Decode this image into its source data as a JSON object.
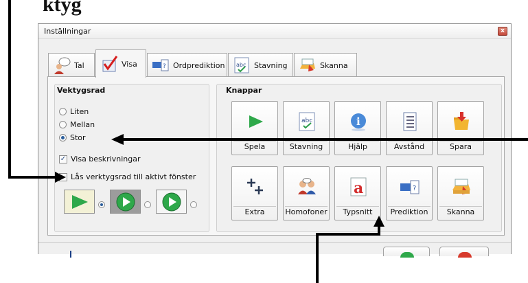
{
  "heading": "ktyg",
  "window": {
    "title": "Inställningar",
    "close_glyph": "x"
  },
  "tabs": [
    {
      "label": "Tal",
      "icon": "speaking-person-icon"
    },
    {
      "label": "Visa",
      "icon": "checkmark-icon",
      "selected": true
    },
    {
      "label": "Ordprediktion",
      "icon": "prediction-icon"
    },
    {
      "label": "Stavning",
      "icon": "spelling-icon"
    },
    {
      "label": "Skanna",
      "icon": "scanner-icon"
    }
  ],
  "toolbar_group": {
    "title": "Vektygsrad",
    "sizes": [
      {
        "label": "Liten",
        "checked": false
      },
      {
        "label": "Mellan",
        "checked": false
      },
      {
        "label": "Stor",
        "checked": true
      }
    ],
    "show_descriptions": {
      "label": "Visa beskrivningar",
      "checked": true
    },
    "lock_toolbar": {
      "label": "Lås verktygsrad till aktivt fönster",
      "checked": false
    },
    "play_styles_selected": 0
  },
  "buttons_group": {
    "title": "Knappar",
    "buttons": [
      {
        "label": "Spela",
        "icon": "play-icon"
      },
      {
        "label": "Stavning",
        "icon": "spelling-icon"
      },
      {
        "label": "Hjälp",
        "icon": "info-icon"
      },
      {
        "label": "Avstånd",
        "icon": "line-spacing-icon"
      },
      {
        "label": "Spara",
        "icon": "save-folder-icon"
      },
      {
        "label": "Extra",
        "icon": "plus-icon"
      },
      {
        "label": "Homofoner",
        "icon": "people-icon"
      },
      {
        "label": "Typsnitt",
        "icon": "font-icon"
      },
      {
        "label": "Prediktion",
        "icon": "prediction-icon"
      },
      {
        "label": "Skanna",
        "icon": "scanner-icon"
      }
    ]
  },
  "colors": {
    "accent": "#2a5d9b",
    "play_green": "#2ea84a"
  }
}
